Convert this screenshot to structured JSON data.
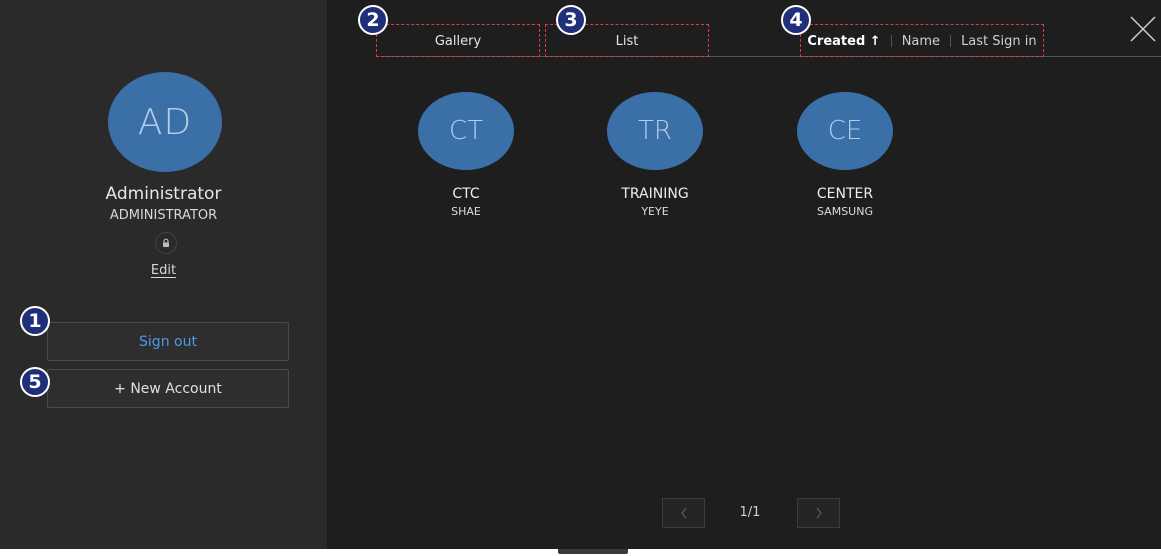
{
  "sidebar": {
    "avatar_initials": "AD",
    "user_name": "Administrator",
    "user_role": "ADMINISTRATOR",
    "edit_label": "Edit",
    "sign_out_label": "Sign out",
    "new_account_label": "+ New Account"
  },
  "tabs": {
    "gallery_label": "Gallery",
    "list_label": "List"
  },
  "sort": {
    "created_label": "Created",
    "created_arrow": "↑",
    "name_label": "Name",
    "last_sign_in_label": "Last Sign in"
  },
  "accounts": [
    {
      "initials": "CT",
      "name": "CTC",
      "sub": "SHAE"
    },
    {
      "initials": "TR",
      "name": "TRAINING",
      "sub": "YEYE"
    },
    {
      "initials": "CE",
      "name": "CENTER",
      "sub": "SAMSUNG"
    }
  ],
  "pagination": {
    "text": "1/1"
  },
  "callouts": {
    "one": "1",
    "two": "2",
    "three": "3",
    "four": "4",
    "five": "5"
  },
  "colors": {
    "background": "#1e1e1e",
    "sidebar": "#2a2a2a",
    "avatar": "#3a6fa8",
    "sign_out_text": "#4e9ae8",
    "callout_fill": "#1f2f7a",
    "callout_box": "#e23b3b"
  },
  "icons": {
    "lock": "lock-icon",
    "close": "close-icon",
    "prev": "chevron-left-icon",
    "next": "chevron-right-icon"
  }
}
